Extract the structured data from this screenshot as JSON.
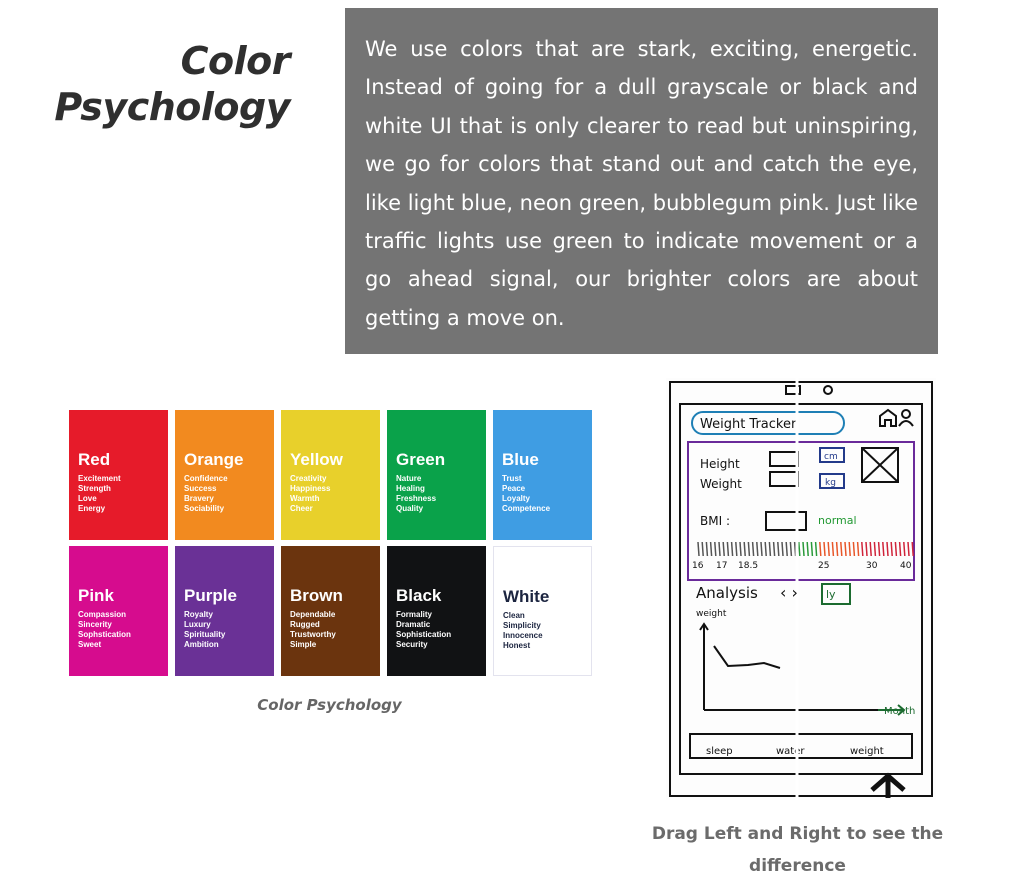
{
  "heading": "Color Psychology",
  "paragraph": "We use colors that are stark, exciting, energetic. Instead of going for a dull grayscale or black and white UI that is only clearer to read but uninspiring, we go for colors that stand out and catch the eye, like light blue, neon green, bubblegum pink. Just like traffic lights use green to indicate movement or a go ahead signal, our brighter colors are about getting a move on.",
  "swatches": [
    {
      "name": "Red",
      "traits": "Excitement\nStrength\nLove\nEnergy",
      "color": "#e61b2a"
    },
    {
      "name": "Orange",
      "traits": "Confidence\nSuccess\nBravery\nSociability",
      "color": "#f28a1f"
    },
    {
      "name": "Yellow",
      "traits": "Creativity\nHappiness\nWarmth\nCheer",
      "color": "#e8d02b"
    },
    {
      "name": "Green",
      "traits": "Nature\nHealing\nFreshness\nQuality",
      "color": "#0aa24a"
    },
    {
      "name": "Blue",
      "traits": "Trust\nPeace\nLoyalty\nCompetence",
      "color": "#3f9de3"
    },
    {
      "name": "Pink",
      "traits": "Compassion\nSincerity\nSophstication\nSweet",
      "color": "#d60c8e"
    },
    {
      "name": "Purple",
      "traits": "Royalty\nLuxury\nSpirituality\nAmbition",
      "color": "#6a3196"
    },
    {
      "name": "Brown",
      "traits": "Dependable\nRugged\nTrustworthy\nSimple",
      "color": "#6b340e"
    },
    {
      "name": "Black",
      "traits": "Formality\nDramatic\nSophistication\nSecurity",
      "color": "#111214"
    },
    {
      "name": "White",
      "traits": "Clean\nSimplicity\nInnocence\nHonest",
      "color": "#ffffff"
    }
  ],
  "image_caption": "Color Psychology",
  "sketch": {
    "title": "Weight Tracker",
    "height": "Height",
    "weight": "Weight",
    "cm": "cm",
    "kg": "kg",
    "bmi": "BMI :",
    "status": "normal",
    "scale": [
      "16",
      "17",
      "18.5",
      "25",
      "30",
      "40"
    ],
    "analysis": "Analysis",
    "analysis_tab": "ly",
    "y_axis": "weight",
    "x_axis": "Month",
    "nav": [
      "sleep",
      "water",
      "weight"
    ]
  },
  "compare_caption": "Drag Left and Right to see the difference"
}
